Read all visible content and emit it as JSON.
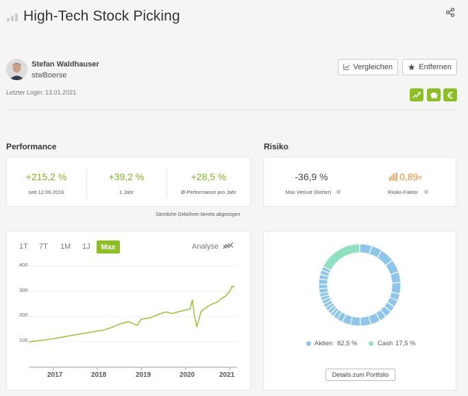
{
  "header": {
    "title": "High-Tech Stock Picking"
  },
  "user": {
    "name": "Stefan Waldhauser",
    "handle": "stwBoerse",
    "last_login": "Letzter Login: 13.01.2021"
  },
  "actions": {
    "compare_label": "Vergleichen",
    "remove_label": "Entfernen"
  },
  "performance": {
    "title": "Performance",
    "stats": [
      {
        "value": "+215,2 %",
        "label": "seit 12.06.2016"
      },
      {
        "value": "+39,2 %",
        "label": "1 Jahr"
      },
      {
        "value": "+28,5 %",
        "label": "Ø-Performance pro Jahr"
      }
    ],
    "fees_note": "Sämtliche Gebühren bereits abgezogen"
  },
  "risk": {
    "title": "Risiko",
    "max_loss": {
      "value": "-36,9 %",
      "label": "Max Verlust (bisher)"
    },
    "factor": {
      "value": "0,89",
      "suffix": "×",
      "label": "Risiko-Faktor"
    }
  },
  "chart_controls": {
    "ranges": [
      "1T",
      "7T",
      "1M",
      "1J",
      "Max"
    ],
    "active": "Max",
    "analyse_label": "Analyse"
  },
  "chart_data": [
    {
      "type": "line",
      "ylim": [
        0,
        400
      ],
      "yticks": [
        "100",
        "200",
        "300",
        "400"
      ],
      "xticks": [
        "2017",
        "2018",
        "2019",
        "2020",
        "2021"
      ],
      "series": [
        {
          "color": "#8cbf26",
          "x": [
            2016.45,
            2016.7,
            2017.0,
            2017.25,
            2017.5,
            2017.75,
            2018.0,
            2018.1,
            2018.3,
            2018.5,
            2018.7,
            2018.9,
            2019.0,
            2019.2,
            2019.4,
            2019.55,
            2019.7,
            2019.9,
            2020.1,
            2020.15,
            2020.2,
            2020.25,
            2020.35,
            2020.5,
            2020.6,
            2020.7,
            2020.8,
            2020.9,
            2021.0,
            2021.05,
            2021.1
          ],
          "y": [
            100,
            105,
            112,
            120,
            128,
            135,
            143,
            145,
            155,
            170,
            180,
            165,
            190,
            195,
            210,
            218,
            212,
            222,
            230,
            265,
            200,
            160,
            220,
            240,
            250,
            255,
            270,
            280,
            300,
            320,
            315
          ]
        }
      ]
    },
    {
      "type": "pie",
      "categories": [
        "Aktien",
        "Cash"
      ],
      "values": [
        82.5,
        17.5
      ],
      "labels": [
        "82,5 %",
        "17,5 %"
      ],
      "colors": [
        "#8ec5ea",
        "#8fe0c0"
      ]
    }
  ],
  "portfolio": {
    "details_label": "Details zum Portfolio"
  }
}
